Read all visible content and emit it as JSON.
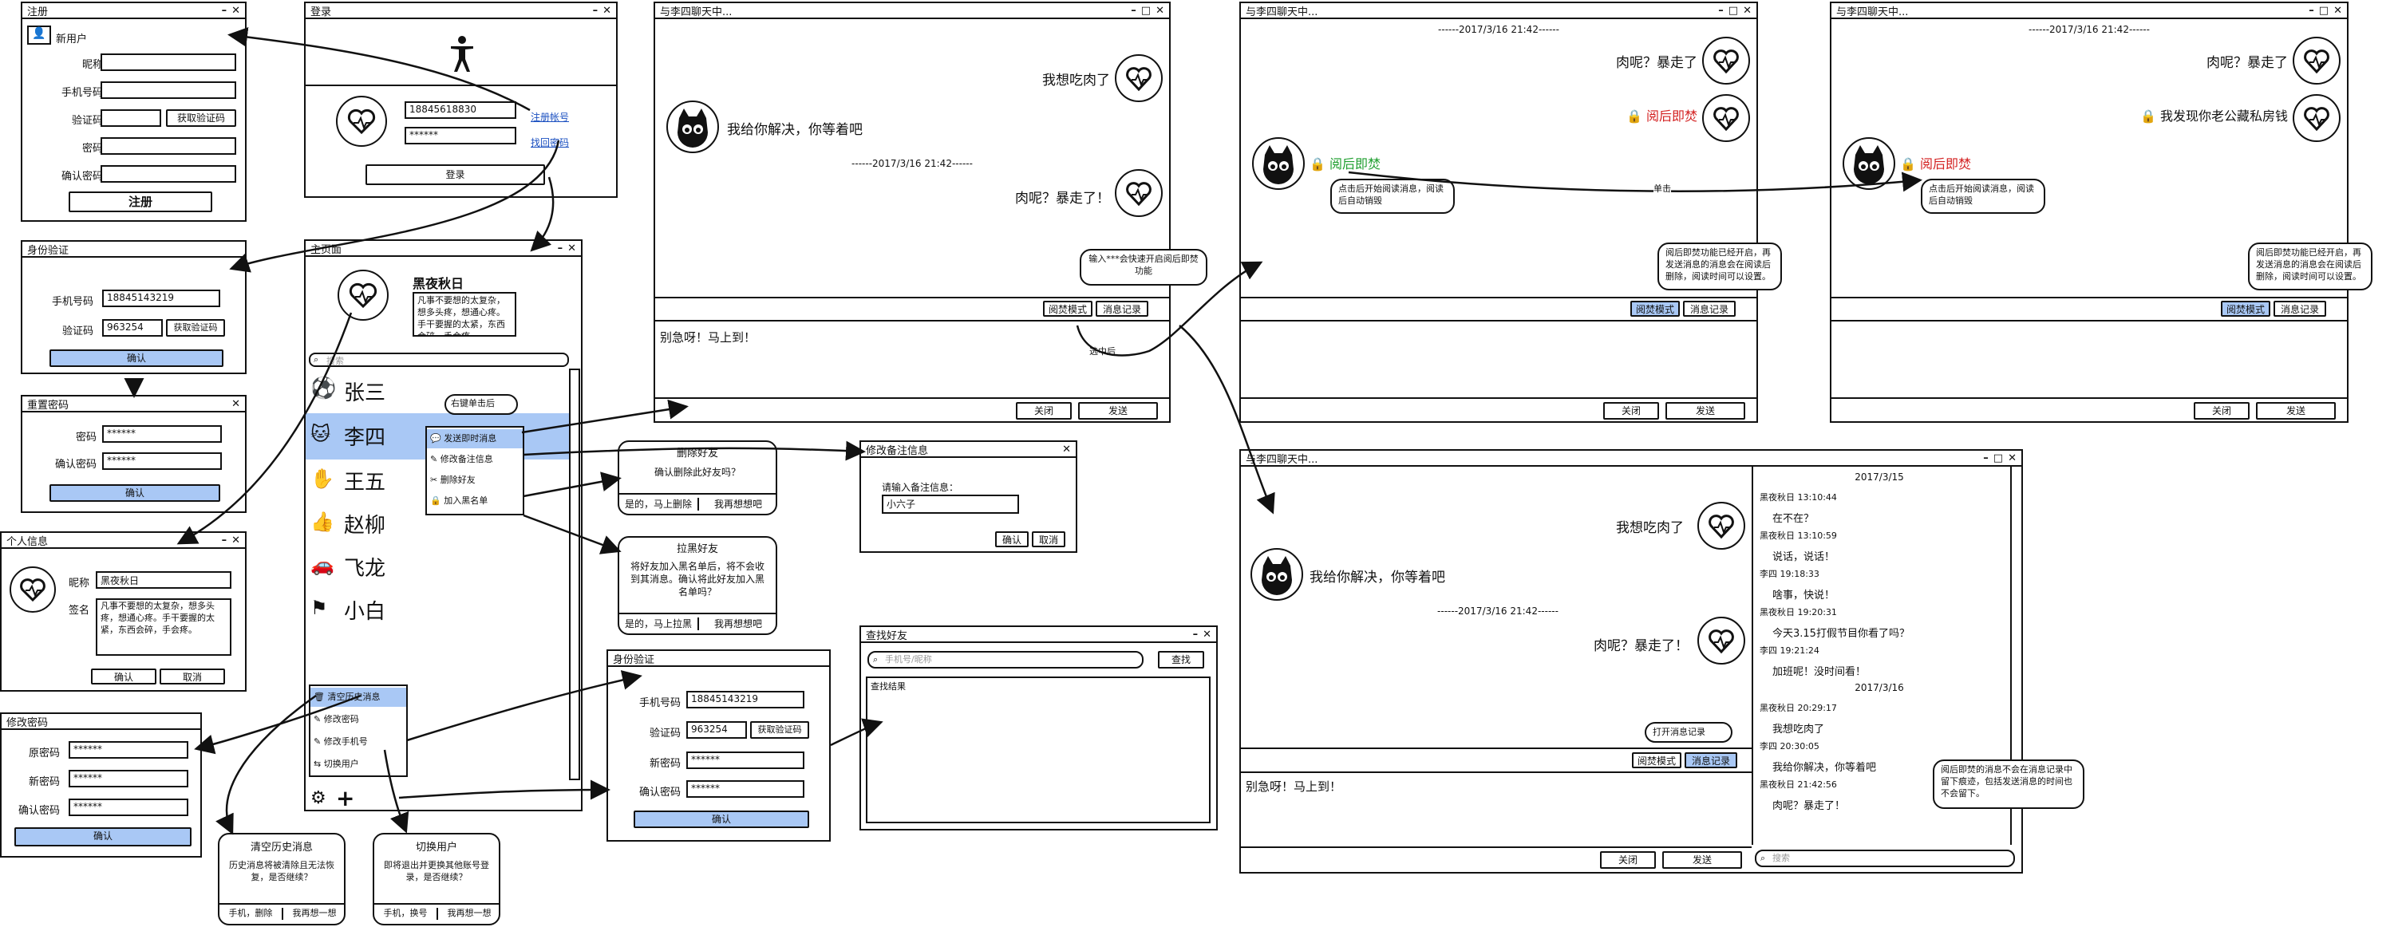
{
  "register": {
    "title": "注册",
    "new_user": "新用户",
    "nickname": "昵称",
    "phone": "手机号码",
    "code": "验证码",
    "get_code": "获取验证码",
    "password": "密码",
    "confirm_pw": "确认密码",
    "submit": "注册"
  },
  "login": {
    "title": "登录",
    "phone_value": "18845618830",
    "pw_value": "******",
    "register_link": "注册帐号",
    "recover_link": "找回密码",
    "submit": "登录"
  },
  "verify1": {
    "title": "身份验证",
    "phone": "手机号码",
    "phone_value": "18845143219",
    "code": "验证码",
    "code_value": "963254",
    "get_code": "获取验证码",
    "confirm": "确认"
  },
  "reset_pw": {
    "title": "重置密码",
    "password": "密码",
    "pw_value": "******",
    "confirm_pw": "确认密码",
    "confirm_value": "******",
    "confirm": "确认"
  },
  "profile": {
    "title": "个人信息",
    "nickname": "昵称",
    "nickname_value": "黑夜秋日",
    "signature": "签名",
    "signature_value": "凡事不要想的太复杂，想多头疼，想通心疼。手干要握的太紧，东西会碎，手会疼。",
    "confirm": "确认",
    "cancel": "取消"
  },
  "change_pw": {
    "title": "修改密码",
    "old": "原密码",
    "old_value": "******",
    "new": "新密码",
    "new_value": "******",
    "confirm": "确认密码",
    "confirm_value": "******",
    "ok": "确认"
  },
  "main": {
    "title": "主页面",
    "username": "黑夜秋日",
    "signature": "凡事不要想的太复杂，想多头疼，想通心疼。手干要握的太紧，东西会碎，手会疼。",
    "search_placeholder": "搜索",
    "contacts": [
      "张三",
      "李四",
      "王五",
      "赵柳",
      "飞龙",
      "小白"
    ],
    "context_menu": [
      "发送即时消息",
      "修改备注信息",
      "删除好友",
      "加入黑名单"
    ],
    "context_note": "右键单击后",
    "bottom_menu": [
      "清空历史消息",
      "修改密码",
      "修改手机号",
      "切换用户"
    ]
  },
  "notes": {
    "delete": {
      "title": "删除好友",
      "body": "确认删除此好友吗？",
      "yes": "是的，马上删除",
      "no": "我再想想吧"
    },
    "blacklist": {
      "title": "拉黑好友",
      "body": "将好友加入黑名单后，将不会收到其消息。确认将此好友加入黑名单吗？",
      "yes": "是的，马上拉黑",
      "no": "我再想想吧"
    },
    "clear": {
      "title": "清空历史消息",
      "body": "历史消息将被清除且无法恢复，是否继续？",
      "yes": "手机，删除",
      "no": "我再想一想"
    },
    "switch": {
      "title": "切换用户",
      "body": "即将退出并更换其他账号登录，是否继续？",
      "yes": "手机，换号",
      "no": "我再想一想"
    },
    "burn_hint": "输入***会快速开启阅后即焚功能",
    "selected": "选中后",
    "click": "单击",
    "burn_info": "阅后即焚功能已经开启，再发送消息的消息会在阅读后删除，阅读时间可以设置。",
    "click_read": "点击后开始阅读消息，阅读后自动销毁",
    "open_history": "打开消息记录",
    "history_info": "阅后即焚的消息不会在消息记录中留下痕迹，包括发送消息的时间也不会留下。"
  },
  "remark": {
    "title": "修改备注信息",
    "prompt": "请输入备注信息：",
    "value": "小六子",
    "ok": "确认",
    "cancel": "取消"
  },
  "find": {
    "title": "查找好友",
    "placeholder": "手机号/昵称",
    "search": "查找",
    "results": "查找结果"
  },
  "verify2": {
    "title": "身份验证",
    "phone": "手机号码",
    "phone_value": "18845143219",
    "code": "验证码",
    "code_value": "963254",
    "get_code": "获取验证码",
    "new_pw": "新密码",
    "new_value": "******",
    "confirm_pw": "确认密码",
    "confirm_value": "******",
    "ok": "确认"
  },
  "chat": {
    "title": "与李四聊天中...",
    "m1": "我想吃肉了",
    "m2": "我给你解决，你等着吧",
    "ts": "------2017/3/16 21:42------",
    "m3": "肉呢？暴走了！",
    "input": "别急呀！马上到！",
    "burn_mode": "阅焚模式",
    "history": "消息记录",
    "close": "关闭",
    "send": "发送"
  },
  "chat2": {
    "title": "与李四聊天中...",
    "ts": "------2017/3/16 21:42------",
    "m1": "肉呢？暴走了",
    "burn": "阅后即焚",
    "burn_mode": "阅焚模式",
    "history": "消息记录",
    "close": "关闭",
    "send": "发送"
  },
  "chat3": {
    "title": "与李四聊天中...",
    "ts": "------2017/3/16 21:42------",
    "m1": "肉呢？暴走了",
    "m2": "我发现你老公藏私房钱",
    "burn": "阅后即焚",
    "burn_mode": "阅焚模式",
    "history": "消息记录",
    "close": "关闭",
    "send": "发送"
  },
  "chat4": {
    "title": "与李四聊天中...",
    "m1": "我想吃肉了",
    "m2": "我给你解决，你等着吧",
    "ts": "------2017/3/16 21:42------",
    "m3": "肉呢？暴走了！",
    "input": "别急呀！马上到！",
    "burn_mode": "阅焚模式",
    "history": "消息记录",
    "close": "关闭",
    "send": "发送",
    "search": "搜索",
    "log": [
      {
        "t": "2017/3/15",
        "h": true
      },
      {
        "t": "黑夜秋日  13:10:44"
      },
      {
        "t": "在不在？",
        "i": true
      },
      {
        "t": "黑夜秋日  13:10:59"
      },
      {
        "t": "说话，说话！",
        "i": true
      },
      {
        "t": "李四  19:18:33"
      },
      {
        "t": "啥事，快说！",
        "i": true
      },
      {
        "t": "黑夜秋日  19:20:31"
      },
      {
        "t": "今天3.15打假节目你看了吗？",
        "i": true
      },
      {
        "t": "李四  19:21:24"
      },
      {
        "t": "加班呢！没时间看！",
        "i": true
      },
      {
        "t": "2017/3/16",
        "h": true
      },
      {
        "t": "黑夜秋日  20:29:17"
      },
      {
        "t": "我想吃肉了",
        "i": true
      },
      {
        "t": "李四  20:30:05"
      },
      {
        "t": "我给你解决，你等着吧",
        "i": true
      },
      {
        "t": "黑夜秋日  21:42:56"
      },
      {
        "t": "肉呢？暴走了！",
        "i": true
      }
    ]
  }
}
